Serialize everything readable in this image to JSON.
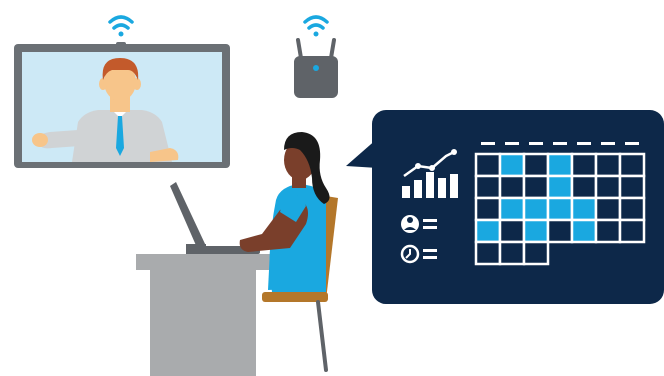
{
  "illustration": {
    "subject": "remote-meeting-scheduling",
    "icons": [
      "wifi-icon",
      "router-icon",
      "analytics-chart-icon",
      "user-list-icon",
      "clock-list-icon",
      "calendar-grid"
    ]
  },
  "colors": {
    "navy": "#0d2849",
    "cyan": "#1aa8e0",
    "gray_frame": "#6b7075",
    "desk_gray": "#a9abad",
    "wood": "#b4772a",
    "skin_dark": "#7a3f2b",
    "skin_light": "#f7c58a",
    "hair_red": "#c35a2b",
    "shirt_gray": "#d0d3d5",
    "screen_blue": "#cde9f6",
    "white": "#ffffff"
  },
  "calendar": {
    "columns": 7,
    "rows": 5,
    "filled_cells": [
      [
        0,
        1
      ],
      [
        0,
        3
      ],
      [
        1,
        3
      ],
      [
        2,
        1
      ],
      [
        2,
        2
      ],
      [
        2,
        3
      ],
      [
        2,
        4
      ],
      [
        3,
        0
      ],
      [
        3,
        2
      ],
      [
        3,
        4
      ]
    ]
  }
}
